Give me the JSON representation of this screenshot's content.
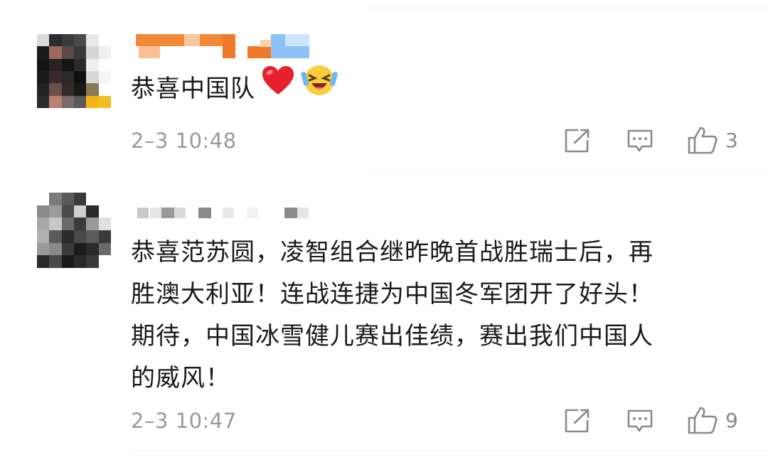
{
  "comments": [
    {
      "text": "恭喜中国队",
      "reactions": [
        "heart",
        "laughing-face"
      ],
      "timestamp": "2–3 10:48",
      "like_count": "3"
    },
    {
      "text_lines": [
        "恭喜范苏圆，凌智组合继昨晚首战胜瑞士后，再",
        "胜澳大利亚！连战连捷为中国冬军团开了好头！",
        "期待，中国冰雪健儿赛出佳绩，赛出我们中国人",
        "的威风！"
      ],
      "timestamp": "2–3 10:47",
      "like_count": "9"
    }
  ],
  "icons": {
    "repost": "repost-icon",
    "reply": "comment-icon",
    "like": "thumbs-up-icon"
  },
  "colors": {
    "text": "#1a1a1a",
    "meta": "#9a9a9a",
    "icon": "#8a8a8a",
    "divider": "#ececec"
  }
}
